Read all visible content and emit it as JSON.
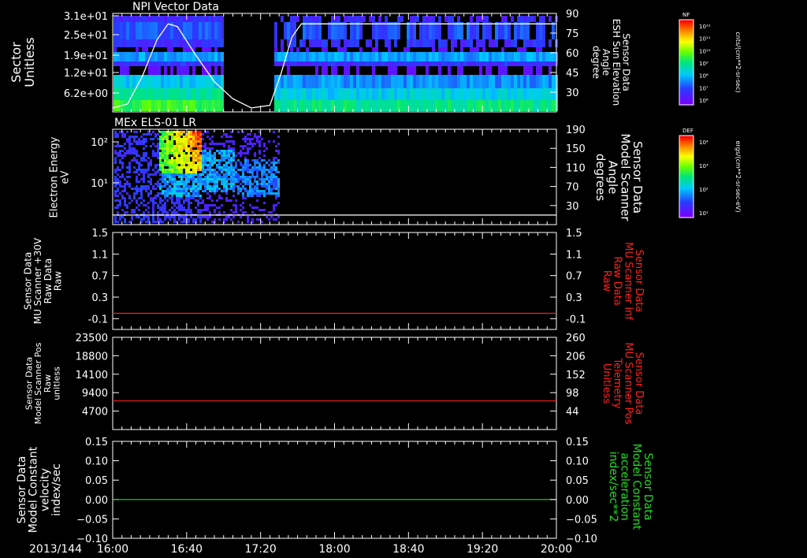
{
  "colors": {
    "background": "#000000",
    "frame": "#ffffff",
    "red_trace": "#ff2020",
    "green_trace": "#22dd22",
    "right_label_red": "#ff2020",
    "right_label_green": "#22dd22"
  },
  "time_axis": {
    "date_label": "2013/144",
    "ticks": [
      "16:00",
      "16:40",
      "17:20",
      "18:00",
      "18:40",
      "19:20",
      "20:00"
    ]
  },
  "colorbars": [
    {
      "label": "NF",
      "units": "cnts/(cm**2-sr-sec)",
      "ticks": [
        "10¹²",
        "10¹¹",
        "10¹⁰",
        "10⁹",
        "10⁸",
        "10⁷",
        "10⁶"
      ]
    },
    {
      "label": "DEF",
      "units": "ergs/(cm**2-sr-sec-eV)",
      "ticks": [
        "10⁴",
        "10³",
        "10²",
        "10¹"
      ]
    }
  ],
  "chart_data": [
    {
      "type": "heatmap",
      "title": "NPI Vector Data",
      "ylabel": "Sector\nUnitless",
      "ytick_labels": [
        "3.1e+01",
        "2.5e+01",
        "1.9e+01",
        "1.2e+01",
        "6.2e+00"
      ],
      "right_ylabel": "Sensor Data\nESH Sun Elevation\nAngle\ndegree",
      "right_ylim": [
        15,
        90
      ],
      "right_ticks": [
        90,
        75,
        60,
        45,
        30
      ],
      "data_gaps": [
        [
          "17:00",
          "17:27"
        ]
      ],
      "overlay_series": {
        "name": "ESH Sun Elevation Angle",
        "t": [
          "16:00",
          "16:08",
          "16:16",
          "16:24",
          "16:30",
          "16:35",
          "16:45",
          "16:55",
          "17:05",
          "17:15",
          "17:25",
          "17:31",
          "17:37",
          "17:42",
          "17:48",
          "20:00"
        ],
        "values": [
          18,
          21,
          42,
          70,
          82,
          80,
          58,
          38,
          25,
          18,
          20,
          44,
          72,
          82,
          82,
          82
        ]
      }
    },
    {
      "type": "heatmap",
      "title": "MEx ELS-01 LR",
      "ylabel": "Electron Energy\neV",
      "ytick_labels": [
        "10²",
        "10¹"
      ],
      "right_ylabel": "Sensor Data\nModel Scanner\nAngle\ndegrees",
      "right_ylim": [
        -10,
        190
      ],
      "right_ticks": [
        190,
        150,
        110,
        70,
        30
      ],
      "data_until": "17:30",
      "overlay_series": {
        "name": "Model Scanner Angle",
        "t": [
          "16:00",
          "20:00"
        ],
        "values": [
          10,
          10
        ]
      }
    },
    {
      "type": "line",
      "ylabel": "Sensor Data\nMU Scanner +30V\nRaw Data\nRaw",
      "ylim": [
        -0.3,
        1.5
      ],
      "yticks": [
        1.5,
        1.1,
        0.7,
        0.3,
        -0.1
      ],
      "right_ylabel": "Sensor Data\nMU Scanner Inf\nRaw Data\nRaw",
      "right_ylim": [
        -0.3,
        1.5
      ],
      "right_ticks": [
        1.5,
        1.1,
        0.7,
        0.3,
        -0.1
      ],
      "series": [
        {
          "t": [
            "16:00",
            "20:00"
          ],
          "values": [
            0.0,
            0.0
          ],
          "color": "#ff2020"
        }
      ]
    },
    {
      "type": "line",
      "ylabel": "Sensor Data\nModel Scanner Pos\nRaw\nunitless",
      "ylim": [
        0,
        23500
      ],
      "yticks": [
        23500,
        18800,
        14100,
        9400,
        4700
      ],
      "right_ylabel": "Sensor Data\nMU Scanner Pos\nTelemetry\nUnitless",
      "right_ylim": [
        -10,
        260
      ],
      "right_ticks": [
        260,
        206,
        152,
        98,
        44
      ],
      "series": [
        {
          "t": [
            "16:00",
            "20:00"
          ],
          "values": [
            7300,
            7300
          ],
          "color": "#ff2020"
        }
      ]
    },
    {
      "type": "line",
      "ylabel": "Sensor Data\nModel Constant\nvelocity\nindex/sec",
      "ylim": [
        -0.1,
        0.15
      ],
      "yticks": [
        0.15,
        0.1,
        0.05,
        0.0,
        -0.05,
        -0.1
      ],
      "ytick_labels": [
        "0.15",
        "0.10",
        "0.05",
        "0.00",
        "−0.05",
        "−0.10"
      ],
      "right_ylabel": "Sensor Data\nModel Constant\nacceleration\nindex/sec**2",
      "right_ylim": [
        -0.1,
        0.15
      ],
      "right_ticks": [
        0.15,
        0.1,
        0.05,
        0.0,
        -0.05,
        -0.1
      ],
      "right_tick_labels": [
        "0.15",
        "0.10",
        "0.05",
        "0.00",
        "−0.05",
        "−0.10"
      ],
      "series": [
        {
          "t": [
            "16:00",
            "20:00"
          ],
          "values": [
            0.0,
            0.0
          ],
          "color": "#22dd22"
        }
      ]
    }
  ]
}
